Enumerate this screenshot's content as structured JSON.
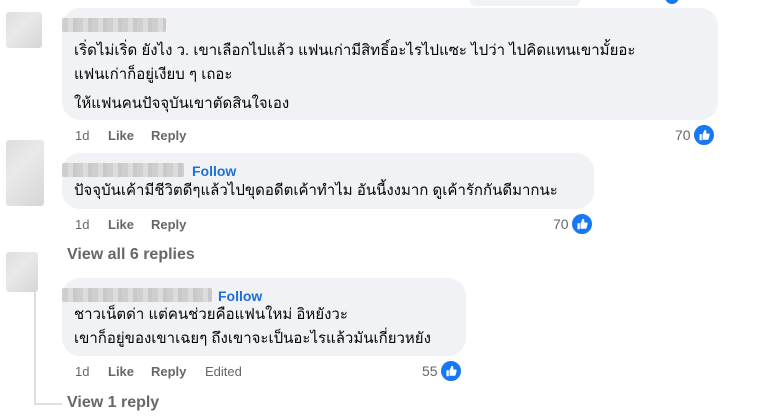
{
  "comments": [
    {
      "lines": [
        "เริ่ดไม่เริ่ด ยังไง ว. เขาเลือกไปแล้ว แฟนเก่ามีสิทธิ์อะไรไปแซะ ไปว่า ไปคิดแทนเขามั้ยอะ",
        "แฟนเก่าก็อยู่เงียบ ๆ เถอะ",
        "ให้แฟนคนปัจจุบันเขาตัดสินใจเอง"
      ],
      "time": "1d",
      "like_label": "Like",
      "reply_label": "Reply",
      "reaction_count": "70"
    },
    {
      "follow_label": "Follow",
      "lines": [
        "ปัจจุบันเค้ามีชีวิตดีๆแล้วไปขุดอดีตเค้าทำไม อันนี้งงมาก ดูเค้ารักกันดีมากนะ"
      ],
      "time": "1d",
      "like_label": "Like",
      "reply_label": "Reply",
      "reaction_count": "70",
      "view_replies": "View all 6 replies"
    },
    {
      "follow_label": "Follow",
      "lines": [
        "ชาวเน็ตด่า แต่คนช่วยคือแฟนใหม่ อิหยังวะ",
        "เขาก็อยู่ของเขาเฉยๆ ถึงเขาจะเป็นอะไรแล้วมันเกี่ยวหยัง"
      ],
      "time": "1d",
      "like_label": "Like",
      "reply_label": "Reply",
      "edited_label": "Edited",
      "reaction_count": "55",
      "view_replies": "View 1 reply"
    }
  ],
  "colors": {
    "bubble": "#f0f2f5",
    "meta": "#65676b",
    "follow": "#1e6fd9",
    "like": "#1877f2"
  }
}
